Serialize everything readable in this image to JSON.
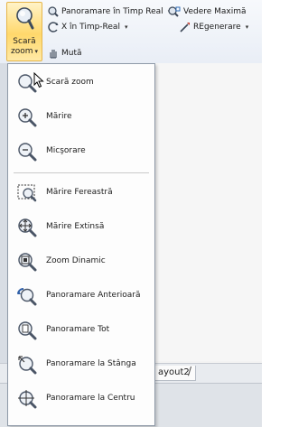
{
  "ribbon": {
    "zoom_button": {
      "label_line1": "Scară",
      "label_line2": "zoom",
      "icon": "magnifier-icon"
    },
    "pan_realtime": {
      "label": "Panoramare în Timp Real",
      "icon": "pan-hand-icon"
    },
    "view_max": {
      "label": "Vedere Maximă",
      "icon": "view-max-icon"
    },
    "x_realtime": {
      "label": "X în Timp-Real",
      "icon": "orbit-icon"
    },
    "regen": {
      "label": "REgenerare",
      "icon": "regen-icon"
    },
    "move": {
      "label": "Mută",
      "icon": "hand-icon"
    }
  },
  "zoom_menu": {
    "items": [
      {
        "label": "Scară zoom",
        "icon": "zoom-realtime-icon"
      },
      {
        "label": "Mărire",
        "icon": "zoom-in-icon"
      },
      {
        "label": "Micşorare",
        "icon": "zoom-out-icon"
      },
      {
        "label": "Mărire Fereastră",
        "icon": "zoom-window-icon"
      },
      {
        "label": "Mărire Extinsă",
        "icon": "zoom-extents-icon"
      },
      {
        "label": "Zoom Dinamic",
        "icon": "zoom-dynamic-icon"
      },
      {
        "label": "Panoramare Anterioară",
        "icon": "zoom-previous-icon"
      },
      {
        "label": "Panoramare Tot",
        "icon": "zoom-all-icon"
      },
      {
        "label": "Panoramare la Stânga",
        "icon": "zoom-left-icon"
      },
      {
        "label": "Panoramare la Centru",
        "icon": "zoom-center-icon"
      }
    ]
  },
  "layout_tabs": {
    "tab": "ayout2",
    "divider": "/"
  }
}
